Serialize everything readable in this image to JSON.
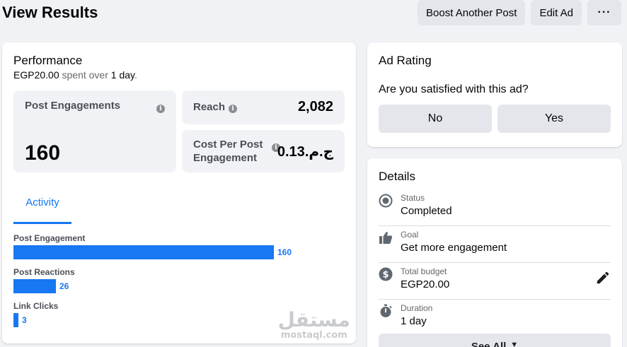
{
  "header": {
    "title": "View Results",
    "boost_label": "Boost Another Post",
    "edit_label": "Edit Ad",
    "more_label": "···"
  },
  "performance": {
    "title": "Performance",
    "spent_amount": "EGP20.00",
    "spent_text": "spent over",
    "duration": "1 day",
    "metrics": {
      "engagements": {
        "label": "Post Engagements",
        "value": "160"
      },
      "reach": {
        "label": "Reach",
        "value": "2,082"
      },
      "cost": {
        "label": "Cost Per Post Engagement",
        "value": "ج.م.0.13"
      }
    },
    "tab_label": "Activity",
    "activity_max": 160,
    "activity": [
      {
        "label": "Post Engagement",
        "value": 160
      },
      {
        "label": "Post Reactions",
        "value": 26
      },
      {
        "label": "Link Clicks",
        "value": 3
      }
    ]
  },
  "watermark": {
    "arabic": "مستقل",
    "latin": "mostaql.com"
  },
  "ad_rating": {
    "title": "Ad Rating",
    "question": "Are you satisfied with this ad?",
    "no_label": "No",
    "yes_label": "Yes"
  },
  "details": {
    "title": "Details",
    "items": [
      {
        "label": "Status",
        "value": "Completed",
        "icon": "status-icon"
      },
      {
        "label": "Goal",
        "value": "Get more engagement",
        "icon": "thumbs-up-icon"
      },
      {
        "label": "Total budget",
        "value": "EGP20.00",
        "icon": "dollar-icon"
      },
      {
        "label": "Duration",
        "value": "1 day",
        "icon": "stopwatch-icon"
      }
    ],
    "see_all_label": "See All"
  },
  "colors": {
    "accent": "#1877f2",
    "background": "#f0f2f5"
  }
}
